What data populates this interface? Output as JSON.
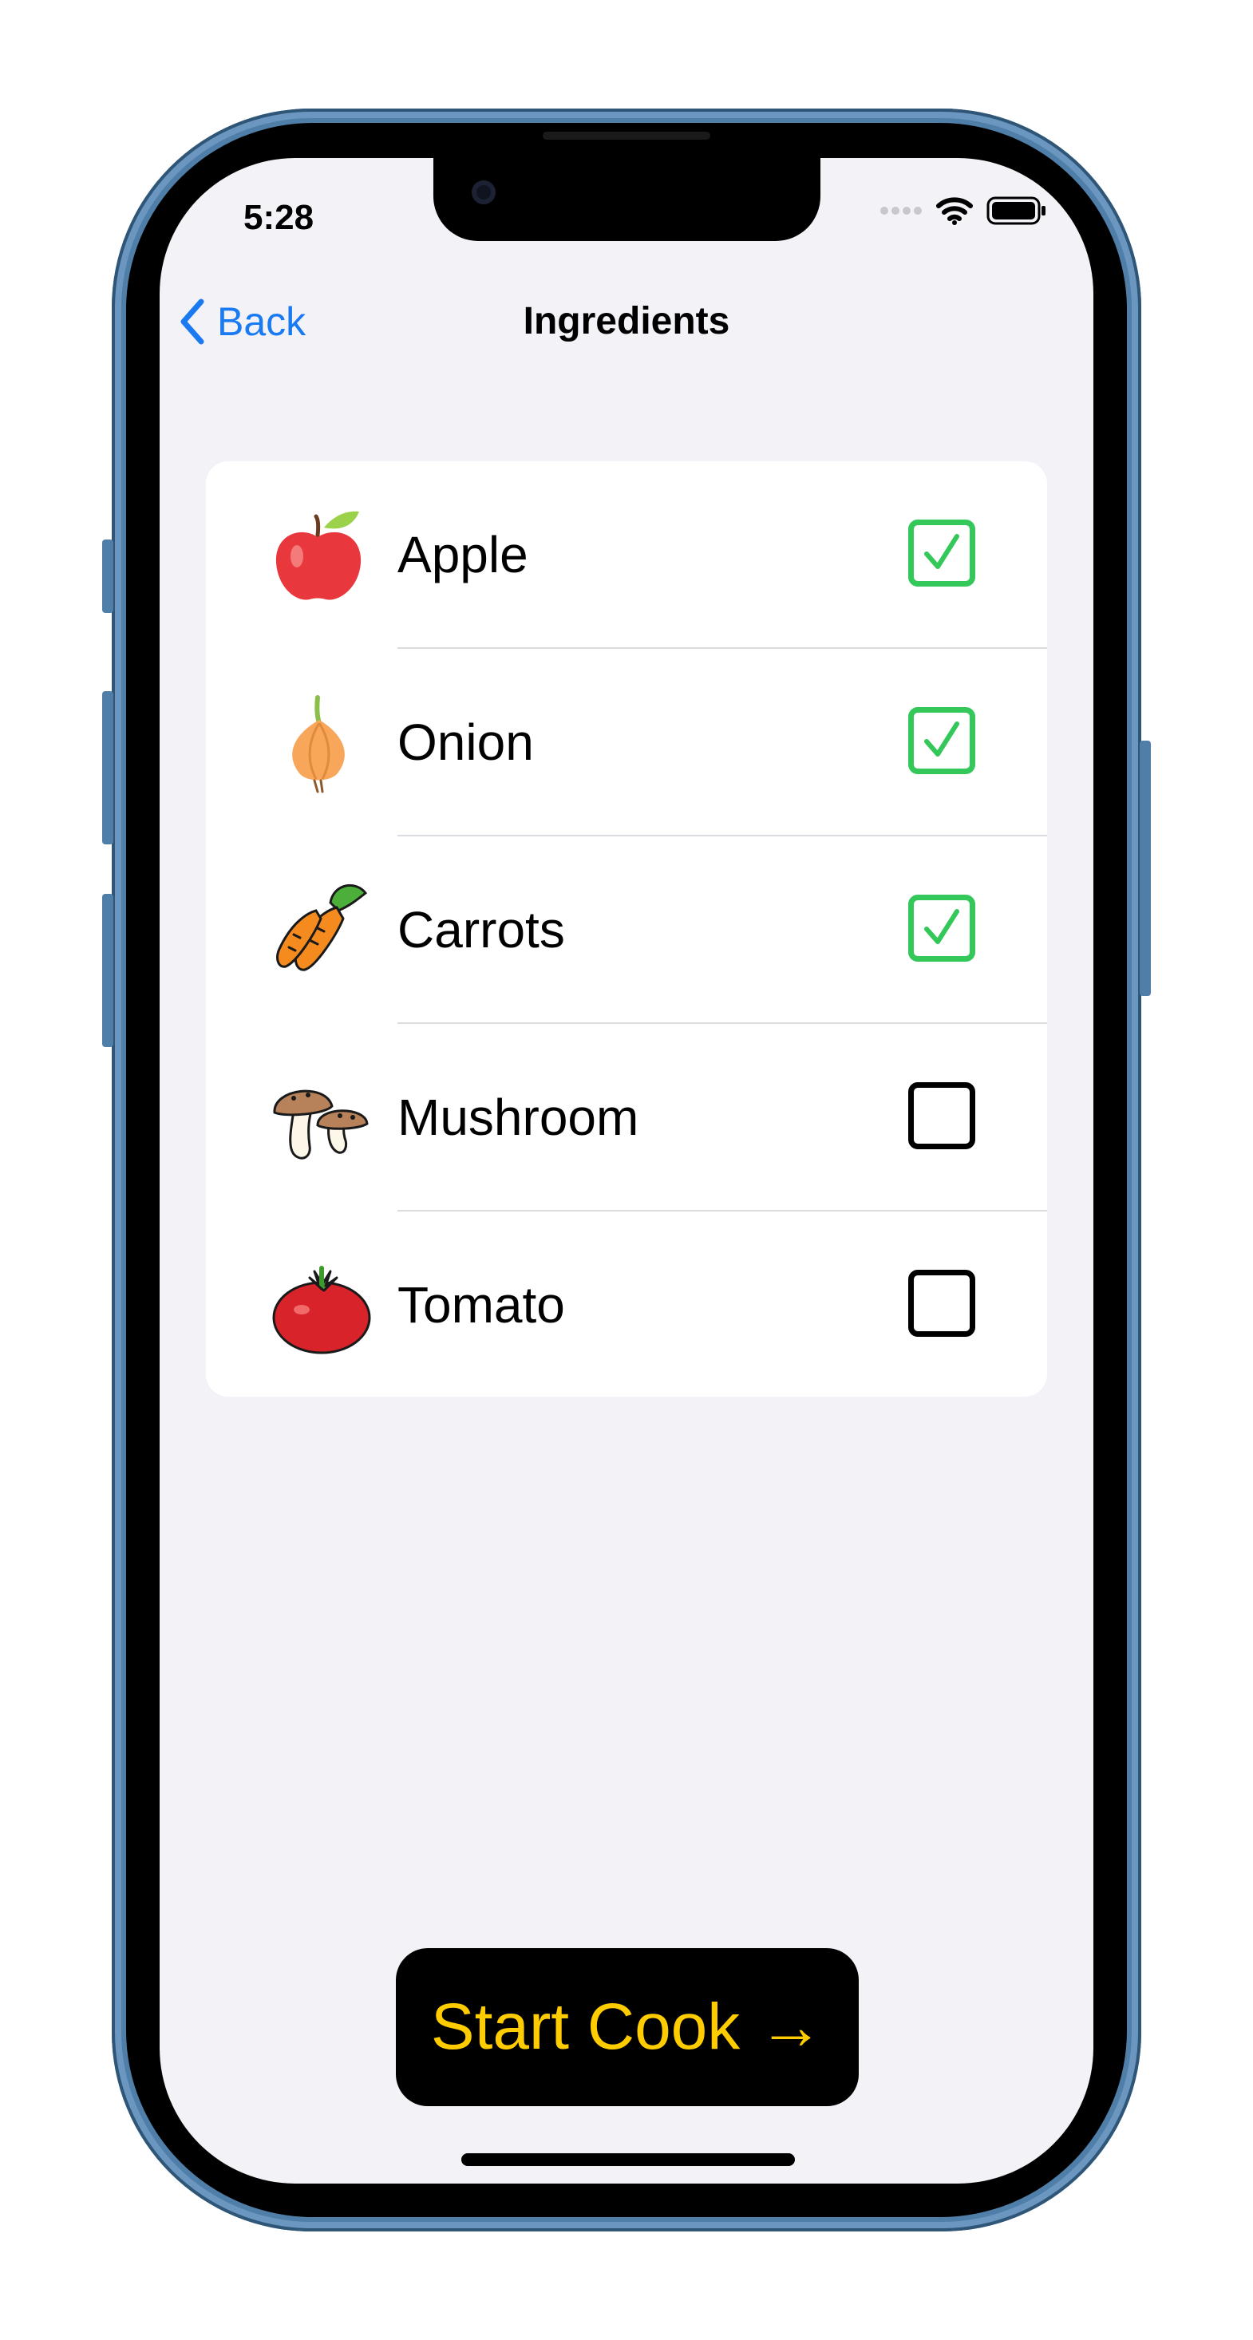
{
  "status_bar": {
    "time": "5:28"
  },
  "nav": {
    "back_label": "Back",
    "title": "Ingredients"
  },
  "ingredients": [
    {
      "name": "Apple",
      "icon": "apple-icon",
      "checked": true
    },
    {
      "name": "Onion",
      "icon": "onion-icon",
      "checked": true
    },
    {
      "name": "Carrots",
      "icon": "carrot-icon",
      "checked": true
    },
    {
      "name": "Mushroom",
      "icon": "mushroom-icon",
      "checked": false
    },
    {
      "name": "Tomato",
      "icon": "tomato-icon",
      "checked": false
    }
  ],
  "cta": {
    "label": "Start Cook →"
  },
  "colors": {
    "accent": "#1a7af2",
    "checked": "#34c759",
    "button_bg": "#000000",
    "button_text": "#ffcc00",
    "screen_bg": "#f2f2f7"
  }
}
